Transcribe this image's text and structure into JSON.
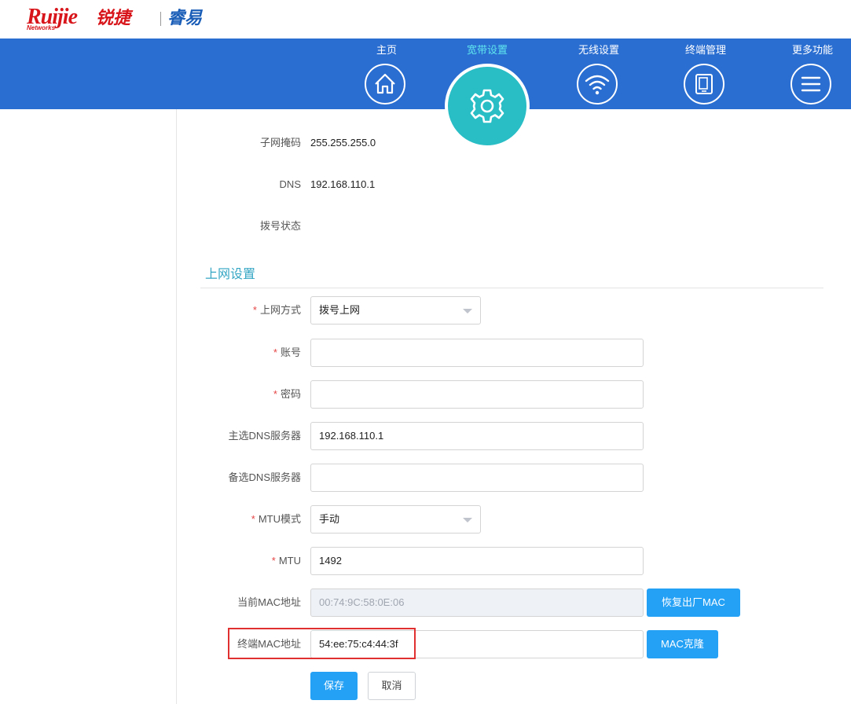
{
  "brand": {
    "logo_text": "Ruijie",
    "logo_sub": "Networks",
    "logo_cn": "锐捷",
    "product": "睿易"
  },
  "nav": {
    "items": [
      {
        "label": "主页",
        "icon": "home-icon"
      },
      {
        "label": "宽带设置",
        "icon": "gear-icon",
        "active": true
      },
      {
        "label": "无线设置",
        "icon": "wifi-icon"
      },
      {
        "label": "终端管理",
        "icon": "devices-icon"
      },
      {
        "label": "更多功能",
        "icon": "menu-icon"
      }
    ],
    "active_color": "#5ee6ee",
    "bar_color": "#2b6ed1",
    "active_circle_color": "#29bdc6"
  },
  "status": {
    "subnet_label": "子网掩码",
    "subnet_value": "255.255.255.0",
    "dns_label": "DNS",
    "dns_value": "192.168.110.1",
    "dial_label": "拨号状态",
    "dial_value": ""
  },
  "form": {
    "section_title": "上网设置",
    "required_mark": "*",
    "mode_label": "上网方式",
    "mode_value": "拨号上网",
    "account_label": "账号",
    "account_value": "",
    "password_label": "密码",
    "password_value": "",
    "dns1_label": "主选DNS服务器",
    "dns1_value": "192.168.110.1",
    "dns2_label": "备选DNS服务器",
    "dns2_value": "",
    "mtu_mode_label": "MTU模式",
    "mtu_mode_value": "手动",
    "mtu_label": "MTU",
    "mtu_value": "1492",
    "cur_mac_label": "当前MAC地址",
    "cur_mac_value": "00:74:9C:58:0E:06",
    "restore_mac_btn": "恢复出厂MAC",
    "term_mac_label": "终端MAC地址",
    "term_mac_value": "54:ee:75:c4:44:3f",
    "clone_mac_btn": "MAC克隆",
    "save_btn": "保存",
    "cancel_btn": "取消"
  },
  "colors": {
    "primary_button": "#24a0f5",
    "highlight": "#e03030",
    "section_title": "#35a6c4"
  }
}
